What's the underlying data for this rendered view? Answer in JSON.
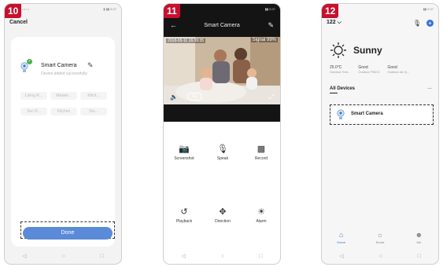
{
  "steps": {
    "s10": "10",
    "s11": "11",
    "s12": "12"
  },
  "colors": {
    "accent": "#3a74d6",
    "step_badge": "#c8102e",
    "done_button": "#5b8bd8"
  },
  "phone10": {
    "status_left": "•·• • •",
    "status_right": "▮ ▮▮ 5:37",
    "cancel": "Cancel",
    "device_name": "Smart Camera",
    "device_subtitle": "Device added successfully",
    "rooms": [
      "Living R...",
      "Master...",
      "Kitch...",
      "Sec R...",
      "Kitchen",
      "Stu..."
    ],
    "done": "Done"
  },
  "phone11": {
    "status_right": "▮▮ 5:37",
    "title": "Smart Camera",
    "timestamp": "2018-05-11 16:36:35",
    "signal": "Signal 99%",
    "resolution": "SD",
    "functions": [
      {
        "label": "Screenshot",
        "icon": "camera-icon"
      },
      {
        "label": "Speak",
        "icon": "microphone-icon"
      },
      {
        "label": "Record",
        "icon": "video-icon"
      },
      {
        "label": "Playback",
        "icon": "playback-icon"
      },
      {
        "label": "Direction",
        "icon": "direction-icon"
      },
      {
        "label": "Alarm",
        "icon": "alarm-icon"
      }
    ]
  },
  "phone12": {
    "status_right": "▮▮ 5:37",
    "home": "122 ⌵",
    "weather": "Sunny",
    "stats": [
      {
        "value": "25.0°C",
        "label": "Outdoor Tem..."
      },
      {
        "value": "Good",
        "label": "Outdoor PM2.5"
      },
      {
        "value": "Good",
        "label": "Outdoor Air Q..."
      }
    ],
    "tab_all": "All Devices",
    "tab_more": "...",
    "device": "Smart Camera",
    "nav": [
      {
        "label": "Home",
        "icon": "home-icon"
      },
      {
        "label": "Smart",
        "icon": "smart-icon"
      },
      {
        "label": "Me",
        "icon": "profile-icon"
      }
    ]
  }
}
